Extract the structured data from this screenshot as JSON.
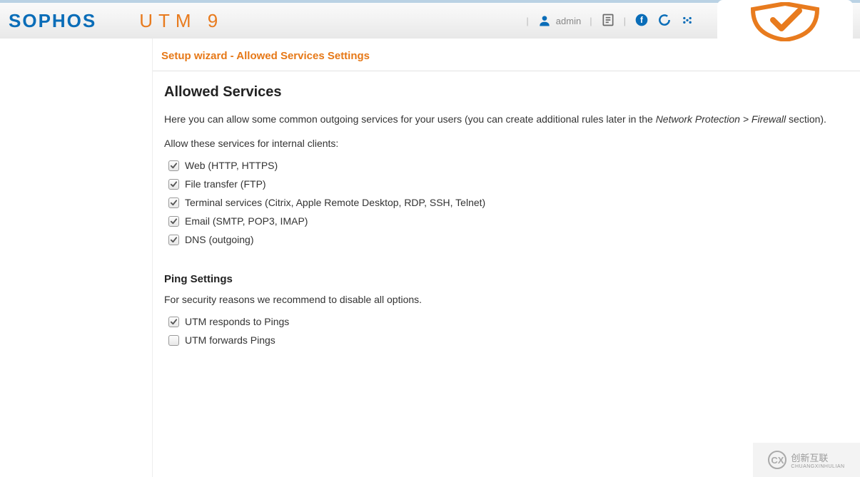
{
  "header": {
    "logo_primary": "SOPHOS",
    "logo_secondary": "UTM 9",
    "user_label": "admin"
  },
  "page": {
    "wizard_title": "Setup wizard - Allowed Services Settings",
    "section_title": "Allowed Services",
    "description_pre": "Here you can allow some common outgoing services for your users (you can create additional rules later in the ",
    "description_italic": "Network Protection > Firewall",
    "description_post": " section).",
    "services_prompt": "Allow these services for internal clients:",
    "services": [
      {
        "label": "Web (HTTP, HTTPS)",
        "checked": true
      },
      {
        "label": "File transfer (FTP)",
        "checked": true
      },
      {
        "label": "Terminal services (Citrix, Apple Remote Desktop, RDP, SSH, Telnet)",
        "checked": true
      },
      {
        "label": "Email (SMTP, POP3, IMAP)",
        "checked": true
      },
      {
        "label": "DNS (outgoing)",
        "checked": true
      }
    ],
    "ping_title": "Ping Settings",
    "ping_description": "For security reasons we recommend to disable all options.",
    "ping_options": [
      {
        "label": "UTM responds to Pings",
        "checked": true
      },
      {
        "label": "UTM forwards Pings",
        "checked": false
      }
    ]
  },
  "watermark": {
    "text": "创新互联",
    "sub": "CHUANGXINHULIAN"
  }
}
